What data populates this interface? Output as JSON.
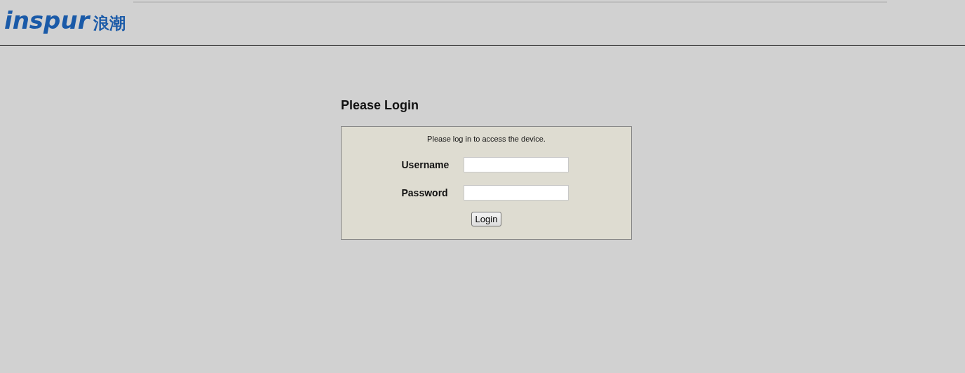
{
  "header": {
    "logo": {
      "wordmark": "inspur",
      "chinese": "浪潮"
    }
  },
  "login": {
    "title": "Please Login",
    "message": "Please log in to access the device.",
    "fields": [
      {
        "label": "Username"
      },
      {
        "label": "Password"
      }
    ],
    "button": "Login"
  }
}
